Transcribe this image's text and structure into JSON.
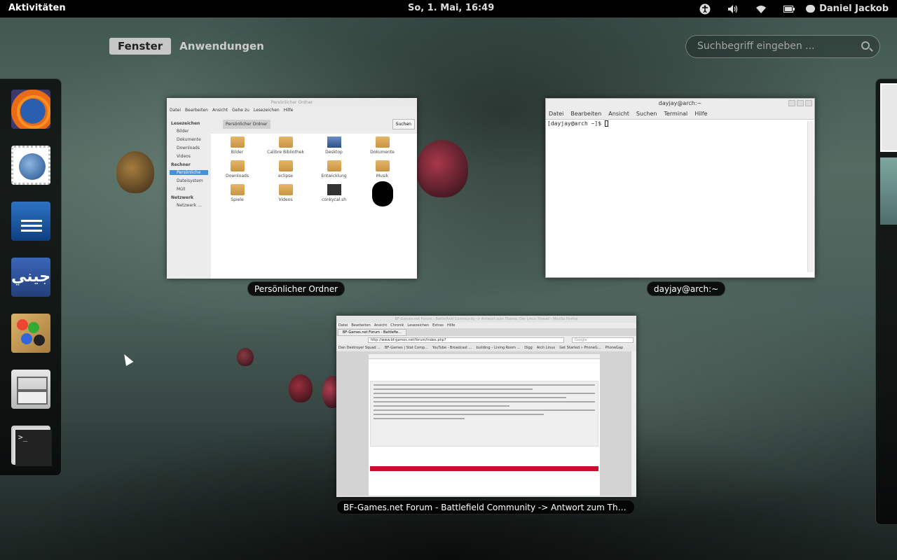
{
  "topbar": {
    "activities": "Aktivitäten",
    "clock": "So,  1. Mai, 16:49",
    "tray_icons": [
      "accessibility-icon",
      "volume-icon",
      "wifi-icon",
      "battery-icon"
    ],
    "user_name": "Daniel Jackob"
  },
  "overview": {
    "tabs": [
      "Fenster",
      "Anwendungen"
    ],
    "active_tab": "Fenster",
    "search_placeholder": "Suchbegriff eingeben ..."
  },
  "dash": {
    "apps": [
      "firefox-icon",
      "thunderbird-icon",
      "libreoffice-writer-icon",
      "jeeny-icon",
      "paint-icon",
      "file-manager-icon",
      "terminal-icon"
    ],
    "jeeny_glyph": "جيني"
  },
  "windows": {
    "nautilus": {
      "caption": "Persönlicher Ordner",
      "title": "Persönlicher Ordner",
      "menu": [
        "Datei",
        "Bearbeiten",
        "Ansicht",
        "Gehe zu",
        "Lesezeichen",
        "Hilfe"
      ],
      "sidebar": {
        "bookmarks_header": "Lesezeichen",
        "bookmarks": [
          "Bilder",
          "Dokumente",
          "Downloads",
          "Videos"
        ],
        "computer_header": "Rechner",
        "computer": [
          "Persönliche",
          "Dateisystem",
          "Müll"
        ],
        "network_header": "Netzwerk",
        "network": [
          "Netzwerk ..."
        ]
      },
      "location": "Persönlicher Ordner",
      "search_button": "Suchen",
      "items": [
        "Bilder",
        "Calibre Bibliothek",
        "Desktop",
        "Dokumente",
        "Downloads",
        "eclipse",
        "Entwicklung",
        "Musik",
        "Spiele",
        "Videos",
        "conkycal.sh",
        ""
      ]
    },
    "terminal": {
      "caption": "dayjay@arch:~",
      "title": "dayjay@arch:~",
      "menu": [
        "Datei",
        "Bearbeiten",
        "Ansicht",
        "Suchen",
        "Terminal",
        "Hilfe"
      ],
      "prompt": "[dayjay@arch ~]$ "
    },
    "browser": {
      "caption": "BF-Games.net Forum - Battlefield Community -> Antwort zum Thema: Der ...",
      "title": "BF-Games.net Forum - Battlefield Community -> Antwort zum Thema: Der Linux Thread - Mozilla Firefox",
      "menu": [
        "Datei",
        "Bearbeiten",
        "Ansicht",
        "Chronik",
        "Lesezeichen",
        "Extras",
        "Hilfe"
      ],
      "tab_label": "BF-Games.net Forum - Battlefie...",
      "url": "http://www.bf-games.net/forum/index.php?",
      "search_placeholder": "Google",
      "bookmarks": [
        "Dan Destroyer Squad ...",
        "BF-Games | Stat Comp...",
        "YouTube - Broadcast ...",
        "building – Living Room ...",
        "Digg",
        "Arch Linux",
        "Get Started » PhoneG...",
        "PhoneGap"
      ]
    }
  }
}
